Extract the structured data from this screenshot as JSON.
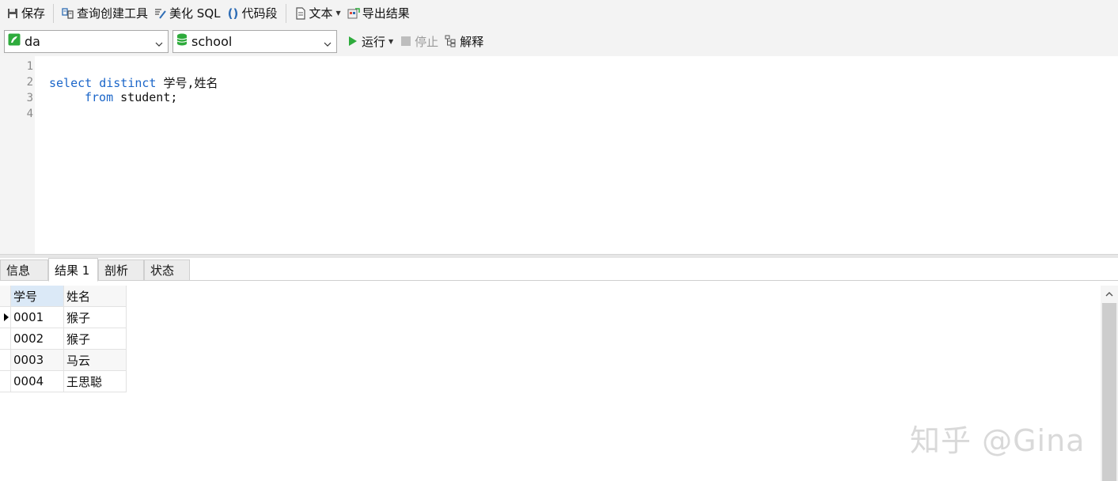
{
  "toolbar": {
    "save_label": "保存",
    "query_builder_label": "查询创建工具",
    "beautify_label": "美化 SQL",
    "snippet_label": "代码段",
    "text_label": "文本",
    "export_label": "导出结果"
  },
  "connection": {
    "value": "da"
  },
  "database": {
    "value": "school"
  },
  "run": {
    "run_label": "运行",
    "stop_label": "停止",
    "explain_label": "解释"
  },
  "editor": {
    "line_numbers": [
      "1",
      "2",
      "3",
      "4"
    ],
    "lines": [
      {
        "kw1": "select",
        "kw2": "distinct",
        "rest": " 学号,姓名"
      },
      {
        "kw": "from",
        "rest": " student;"
      }
    ]
  },
  "tabs": [
    "信息",
    "结果 1",
    "剖析",
    "状态"
  ],
  "active_tab": "结果 1",
  "results": {
    "columns": [
      "学号",
      "姓名"
    ],
    "rows": [
      [
        "0001",
        "猴子"
      ],
      [
        "0002",
        "猴子"
      ],
      [
        "0003",
        "马云"
      ],
      [
        "0004",
        "王思聪"
      ]
    ]
  },
  "watermark": "知乎 @Gina",
  "colors": {
    "keyword": "#1b66c9",
    "run_green": "#2eab3c",
    "selected_header": "#dbe9f7"
  }
}
